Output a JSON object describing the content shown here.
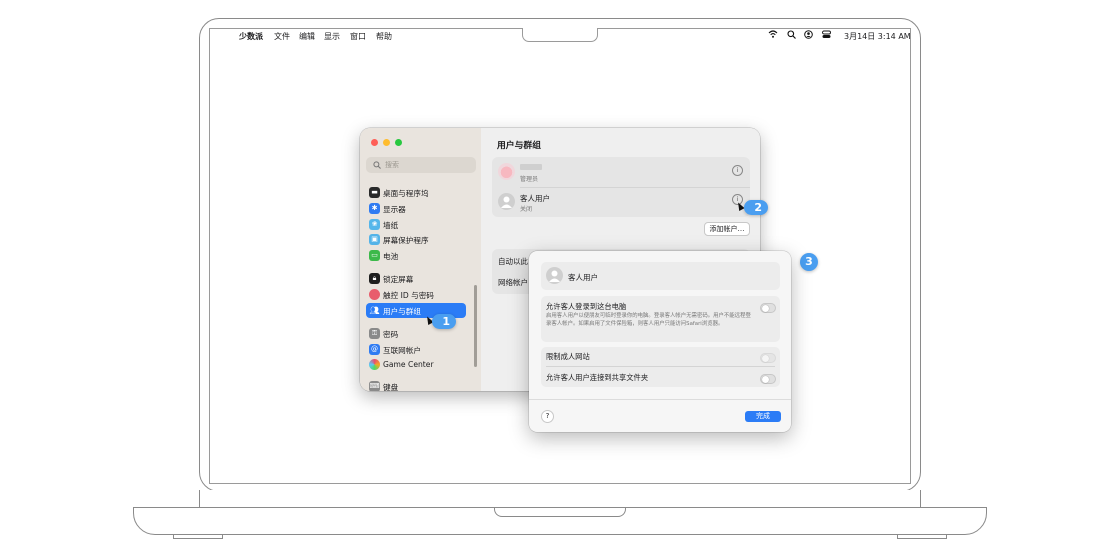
{
  "menubar": {
    "apple_icon": "apple-icon",
    "items": [
      "少数派",
      "文件",
      "编辑",
      "显示",
      "窗口",
      "帮助"
    ],
    "clock": "3月14日  3:14 AM"
  },
  "sidebar": {
    "search_placeholder": "搜索",
    "items": [
      {
        "label": "桌面与程序坞",
        "color": "#2a2a2a"
      },
      {
        "label": "显示器",
        "color": "#2f7bf2"
      },
      {
        "label": "墙纸",
        "color": "#55b6ea"
      },
      {
        "label": "屏幕保护程序",
        "color": "#54b3e8"
      },
      {
        "label": "电池",
        "color": "#3cb94a"
      },
      {
        "label": "锁定屏幕",
        "color": "#1e1e1e"
      },
      {
        "label": "触控 ID 与密码",
        "color": "#e85d6c"
      },
      {
        "label": "用户与群组",
        "color": "#2b7cf6"
      },
      {
        "label": "密码",
        "color": "#8a8a8a"
      },
      {
        "label": "互联网帐户",
        "color": "#2f7bf2"
      },
      {
        "label": "Game Center",
        "color": "#d8506e"
      },
      {
        "label": "键盘",
        "color": "#8a8a8a"
      }
    ]
  },
  "content": {
    "title": "用户与群组",
    "admin_role": "管理员",
    "guest_name": "客人用户",
    "guest_status": "关闭",
    "add_account": "添加帐户…",
    "row_auto_login": "自动以此",
    "row_network": "网络帐户"
  },
  "callouts": [
    "1",
    "2",
    "3"
  ],
  "dialog": {
    "user": "客人用户",
    "allow_login_title": "允许客人登录到这台电脑",
    "allow_login_desc": "启用客人用户以便朋友可临时登录你的电脑。登录客人帐户无需密码。用户不能远程登录客人帐户。如果启用了文件保险箱，则客人用户只能访问Safari浏览器。",
    "restrict_sites": "限制成人网站",
    "allow_shared": "允许客人用户连接到共享文件夹",
    "help": "?",
    "done": "完成"
  },
  "colors": {
    "accent": "#2b7cf6",
    "callout": "#4a9ef0"
  }
}
